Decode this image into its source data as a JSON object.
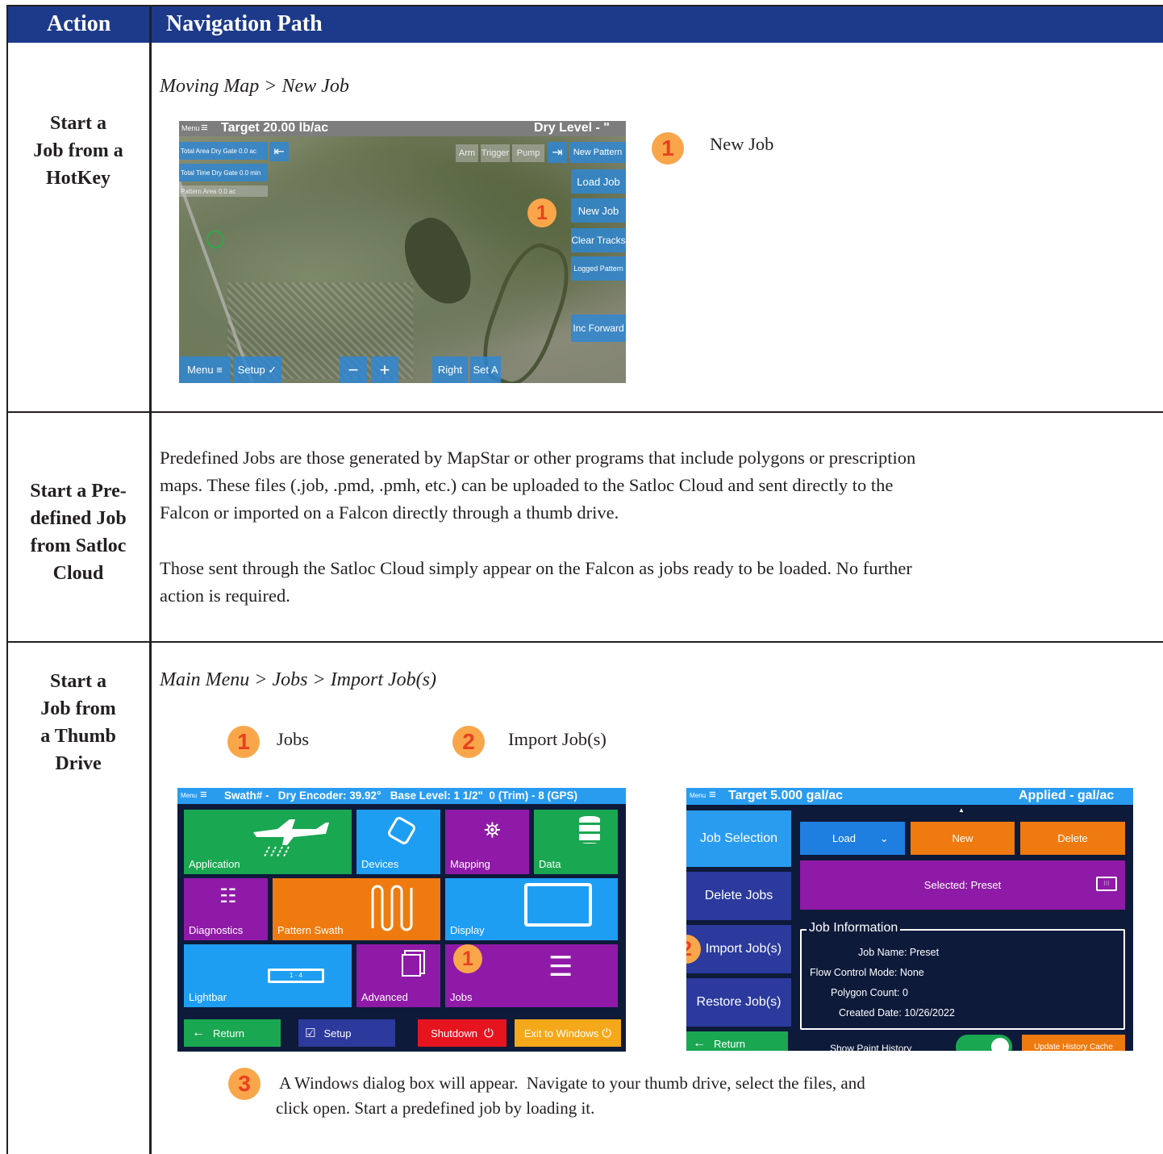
{
  "header": {
    "action": "Action",
    "navigation_path": "Navigation Path"
  },
  "row1": {
    "action_lines": [
      "Start a",
      "Job from a",
      "HotKey"
    ],
    "path": "Moving Map >  New Job",
    "step1": {
      "number": "1",
      "label": "New Job"
    },
    "map": {
      "top_left": "Menu",
      "target": "Target 20.00 lb/ac",
      "status": "Dry Level - \"",
      "stats": [
        "Total Area Dry Gate 0.0 ac",
        "Total Time Dry Gate 0.0 min",
        "Pattern Area       0.0 ac"
      ],
      "top_buttons": [
        "Arm",
        "Trigger",
        "Pump"
      ],
      "side_buttons": [
        "New Pattern",
        "Load Job",
        "New Job",
        "Clear Tracks",
        "Logged Pattern",
        "Inc Forward"
      ],
      "bottom_buttons": {
        "menu": "Menu",
        "setup": "Setup",
        "minus": "−",
        "plus": "+",
        "right": "Right",
        "set_a": "Set A"
      },
      "badge": "1"
    }
  },
  "row2": {
    "action_lines": [
      "Start a Pre-",
      "defined Job",
      "from Satloc",
      "Cloud"
    ],
    "para1": [
      "Predefined Jobs are those generated by MapStar or other programs that include polygons or prescription",
      "maps. These files (.job, .pmd, .pmh, etc.) can be uploaded to the Satloc Cloud and sent directly to the",
      "Falcon or imported on a Falcon directly through a thumb drive."
    ],
    "para2": [
      "Those sent through the Satloc Cloud simply appear on the Falcon as jobs ready to be loaded.  No further",
      "action is required."
    ]
  },
  "row3": {
    "action_lines": [
      "Start a",
      "Job from",
      "a Thumb",
      "Drive"
    ],
    "path": "Main Menu > Jobs > Import Job(s)",
    "step1": {
      "number": "1",
      "label": "Jobs"
    },
    "step2": {
      "number": "2",
      "label": "Import Job(s)"
    },
    "step3": {
      "number": "3",
      "lines": [
        " A Windows dialog box will appear.  Navigate to your thumb drive, select the files, and",
        "click open. Start a predefined job by loading it."
      ]
    },
    "main_menu": {
      "menu": "Menu",
      "status": "Swath# -   Dry Encoder: 39.92°   Base Level: 1 1/2\"  0 (Trim) - 8 (GPS)",
      "tiles": [
        "Application",
        "Devices",
        "Mapping",
        "Data",
        "Diagnostics",
        "Pattern Swath",
        "Display",
        "Lightbar",
        "Advanced",
        "Jobs"
      ],
      "bottom": {
        "return": "Return",
        "setup": "Setup",
        "shutdown": "Shutdown",
        "exit": "Exit to Windows"
      },
      "lightbar_text": "1 · 4",
      "badge": "1"
    },
    "jobs_screen": {
      "menu": "Menu",
      "target": "Target 5.000 gal/ac",
      "applied": "Applied - gal/ac",
      "side": [
        "Job Selection",
        "Delete Jobs",
        "Import Job(s)",
        "Restore Job(s)"
      ],
      "return": "Return",
      "load": "Load",
      "new": "New",
      "delete": "Delete",
      "selected": "Selected: Preset",
      "info_title": "Job Information",
      "info_lines": [
        "Job Name: Preset",
        "Flow Control Mode: None",
        "Polygon Count: 0",
        "Created Date: 10/26/2022"
      ],
      "show_paint": "Show Paint History",
      "update_cache": "Update History Cache",
      "badge": "2"
    }
  },
  "colors": {
    "header_bg": "#1d3a8a",
    "badge": "#f9a64a",
    "badge_text": "#e8411f"
  }
}
